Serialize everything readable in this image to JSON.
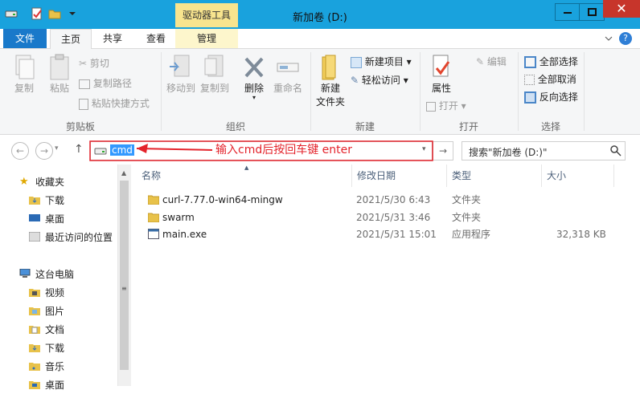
{
  "window": {
    "title": "新加卷 (D:)",
    "context_tab": "驱动器工具",
    "close_glyph": "✕"
  },
  "tabs": {
    "file": "文件",
    "home": "主页",
    "share": "共享",
    "view": "查看",
    "manage": "管理"
  },
  "ribbon": {
    "clipboard": {
      "copy": "复制",
      "paste": "粘贴",
      "cut": "剪切",
      "copy_path": "复制路径",
      "paste_shortcut": "粘贴快捷方式",
      "group": "剪贴板"
    },
    "organize": {
      "move_to": "移动到",
      "copy_to": "复制到",
      "delete": "删除",
      "rename": "重命名",
      "group": "组织"
    },
    "new": {
      "new_folder_line1": "新建",
      "new_folder_line2": "文件夹",
      "new_item": "新建项目",
      "easy_access": "轻松访问",
      "group": "新建"
    },
    "open": {
      "properties": "属性",
      "open": "打开",
      "edit": "编辑",
      "group": "打开"
    },
    "select": {
      "select_all": "全部选择",
      "select_none": "全部取消",
      "invert": "反向选择",
      "group": "选择"
    }
  },
  "address": {
    "value": "cmd",
    "search_placeholder": "搜索\"新加卷 (D:)\""
  },
  "annotation": {
    "text": "输入cmd后按回车键 enter",
    "color": "#e4232b"
  },
  "nav": {
    "favorites": "收藏夹",
    "downloads": "下载",
    "desktop": "桌面",
    "recent": "最近访问的位置",
    "this_pc": "这台电脑",
    "videos": "视频",
    "pictures": "图片",
    "documents": "文档",
    "downloads2": "下载",
    "music": "音乐",
    "desktop2": "桌面"
  },
  "columns": {
    "name": "名称",
    "date": "修改日期",
    "type": "类型",
    "size": "大小"
  },
  "files": [
    {
      "name": "curl-7.77.0-win64-mingw",
      "date": "2021/5/30 6:43",
      "type": "文件夹",
      "size": ""
    },
    {
      "name": "swarm",
      "date": "2021/5/31 3:46",
      "type": "文件夹",
      "size": ""
    },
    {
      "name": "main.exe",
      "date": "2021/5/31 15:01",
      "type": "应用程序",
      "size": "32,318 KB"
    }
  ]
}
